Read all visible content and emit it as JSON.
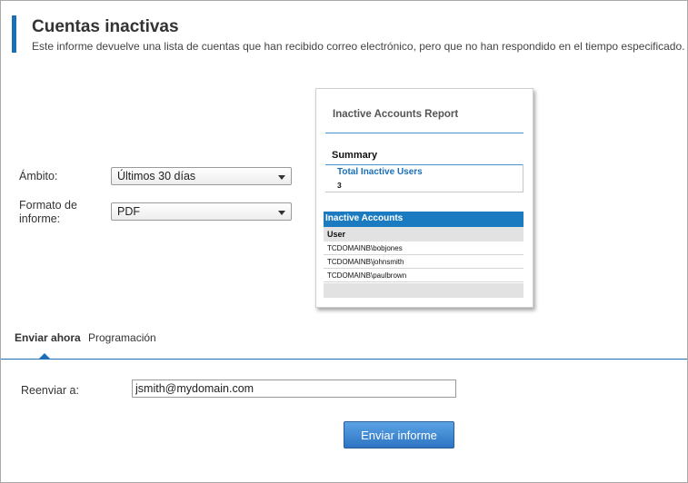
{
  "header": {
    "title": "Cuentas inactivas",
    "subtitle": "Este informe devuelve una lista de cuentas que han recibido correo electrónico, pero que no han respondido en el tiempo especificado."
  },
  "form": {
    "scope_label": "Ámbito:",
    "scope_value": "Últimos 30 días",
    "format_label": "Formato de informe:",
    "format_value": "PDF"
  },
  "preview": {
    "title": "Inactive Accounts Report",
    "summary_label": "Summary",
    "total_label": "Total Inactive Users",
    "total_value": "3",
    "section_header": "Inactive Accounts",
    "column_header": "User",
    "rows": [
      "TCDOMAINB\\bobjones",
      "TCDOMAINB\\johnsmith",
      "TCDOMAINB\\paulbrown"
    ]
  },
  "tabs": [
    {
      "label": "Enviar ahora",
      "active": true
    },
    {
      "label": "Programación",
      "active": false
    }
  ],
  "send_now": {
    "resend_label": "Reenviar a:",
    "resend_value": "jsmith@mydomain.com",
    "send_button_label": "Enviar informe"
  },
  "colors": {
    "accent": "#1a6fb7",
    "button": "#2e74c4"
  }
}
